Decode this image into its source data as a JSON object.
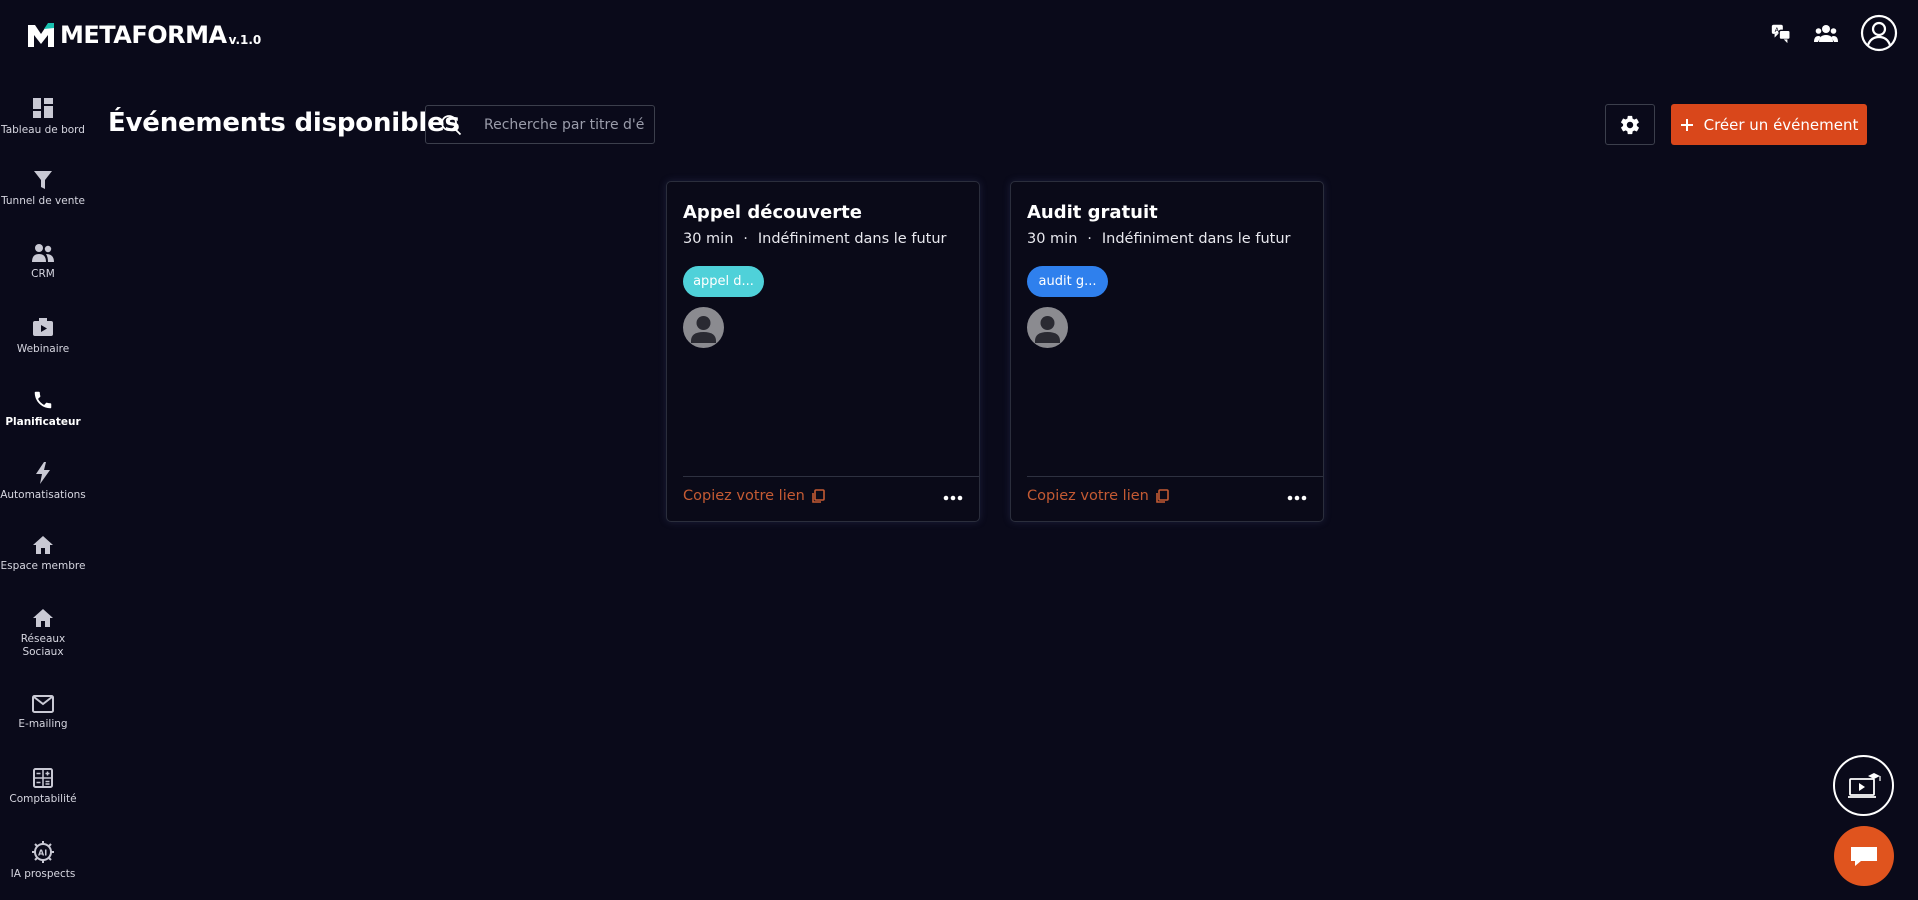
{
  "app": {
    "brand": "METAFORMA",
    "version": "v.1.0"
  },
  "topbar": {
    "icons": [
      "translate-icon",
      "team-icon",
      "account-icon"
    ]
  },
  "sidebar": {
    "items": [
      {
        "label": "Tableau de bord",
        "icon": "dashboard-icon",
        "active": false
      },
      {
        "label": "Tunnel de vente",
        "icon": "funnel-icon",
        "active": false
      },
      {
        "label": "CRM",
        "icon": "crm-icon",
        "active": false
      },
      {
        "label": "Webinaire",
        "icon": "webinar-icon",
        "active": false
      },
      {
        "label": "Planificateur",
        "icon": "phone-icon",
        "active": true
      },
      {
        "label": "Automatisations",
        "icon": "bolt-icon",
        "active": false
      },
      {
        "label": "Espace membre",
        "icon": "home-icon",
        "active": false
      },
      {
        "label": "Réseaux Sociaux",
        "icon": "home-icon",
        "active": false
      },
      {
        "label": "E-mailing",
        "icon": "mail-icon",
        "active": false
      },
      {
        "label": "Comptabilité",
        "icon": "calculator-icon",
        "active": false
      },
      {
        "label": "IA prospects",
        "icon": "ai-icon",
        "active": false
      }
    ]
  },
  "main": {
    "title": "Événements disponibles",
    "search_placeholder": "Recherche par titre d'événement",
    "create_label": "Créer un événement"
  },
  "events": [
    {
      "title": "Appel découverte",
      "duration": "30 min",
      "availability": "Indéfiniment dans le futur",
      "tag": "appel d...",
      "tag_color": "#4fd1d9",
      "copy_label": "Copiez votre lien"
    },
    {
      "title": "Audit gratuit",
      "duration": "30 min",
      "availability": "Indéfiniment dans le futur",
      "tag": "audit g...",
      "tag_color": "#2f80ed",
      "copy_label": "Copiez votre lien"
    }
  ],
  "colors": {
    "background": "#0a0a1a",
    "accent": "#d9471b",
    "link": "#c45a33"
  }
}
